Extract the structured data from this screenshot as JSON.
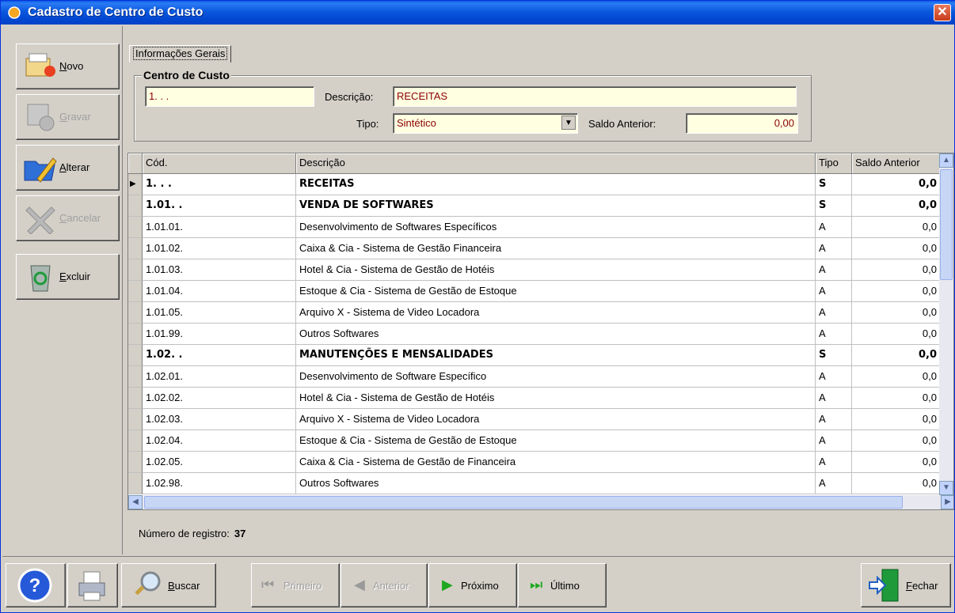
{
  "window": {
    "title": "Cadastro de Centro de Custo",
    "close_glyph": "✕"
  },
  "side_buttons": {
    "novo": {
      "label": "Novo",
      "mnemonic": "N",
      "rest": "ovo",
      "enabled": true
    },
    "gravar": {
      "label": "Gravar",
      "mnemonic": "G",
      "rest": "ravar",
      "enabled": false
    },
    "alterar": {
      "label": "Alterar",
      "mnemonic": "A",
      "rest": "lterar",
      "enabled": true
    },
    "cancelar": {
      "label": "Cancelar",
      "mnemonic": "C",
      "rest": "ancelar",
      "enabled": false
    },
    "excluir": {
      "label": "Excluir",
      "mnemonic": "E",
      "rest": "xcluir",
      "enabled": true
    }
  },
  "tab": {
    "label": "Informações Gerais"
  },
  "form": {
    "group_title": "Centro de Custo",
    "codigo": "1. . .",
    "descricao_label": "Descrição:",
    "descricao": "RECEITAS",
    "tipo_label": "Tipo:",
    "tipo": "Sintético",
    "saldo_label": "Saldo Anterior:",
    "saldo": "0,00"
  },
  "grid": {
    "columns": [
      "Cód.",
      "Descrição",
      "Tipo",
      "Saldo Anterior"
    ],
    "rows": [
      {
        "cod": "1. . .",
        "descricao": "RECEITAS",
        "tipo": "S",
        "saldo": "0,0",
        "bold": true,
        "current": true
      },
      {
        "cod": "1.01. .",
        "descricao": "VENDA DE SOFTWARES",
        "tipo": "S",
        "saldo": "0,0",
        "bold": true
      },
      {
        "cod": "1.01.01.",
        "descricao": "Desenvolvimento de Softwares Específicos",
        "tipo": "A",
        "saldo": "0,0"
      },
      {
        "cod": "1.01.02.",
        "descricao": "Caixa & Cia - Sistema de Gestão Financeira",
        "tipo": "A",
        "saldo": "0,0"
      },
      {
        "cod": "1.01.03.",
        "descricao": "Hotel & Cia - Sistema de Gestão de Hotéis",
        "tipo": "A",
        "saldo": "0,0"
      },
      {
        "cod": "1.01.04.",
        "descricao": "Estoque & Cia - Sistema de Gestão de Estoque",
        "tipo": "A",
        "saldo": "0,0"
      },
      {
        "cod": "1.01.05.",
        "descricao": "Arquivo X - Sistema de Video Locadora",
        "tipo": "A",
        "saldo": "0,0"
      },
      {
        "cod": "1.01.99.",
        "descricao": "Outros Softwares",
        "tipo": "A",
        "saldo": "0,0"
      },
      {
        "cod": "1.02. .",
        "descricao": "MANUTENÇÕES E MENSALIDADES",
        "tipo": "S",
        "saldo": "0,0",
        "bold": true
      },
      {
        "cod": "1.02.01.",
        "descricao": "Desenvolvimento de Software Específico",
        "tipo": "A",
        "saldo": "0,0"
      },
      {
        "cod": "1.02.02.",
        "descricao": "Hotel & Cia - Sistema de Gestão de Hotéis",
        "tipo": "A",
        "saldo": "0,0"
      },
      {
        "cod": "1.02.03.",
        "descricao": "Arquivo X - Sistema de Video Locadora",
        "tipo": "A",
        "saldo": "0,0"
      },
      {
        "cod": "1.02.04.",
        "descricao": "Estoque & Cia - Sistema de Gestão de Estoque",
        "tipo": "A",
        "saldo": "0,0"
      },
      {
        "cod": "1.02.05.",
        "descricao": "Caixa & Cia - Sistema de Gestão de Financeira",
        "tipo": "A",
        "saldo": "0,0"
      },
      {
        "cod": "1.02.98.",
        "descricao": "Outros Softwares",
        "tipo": "A",
        "saldo": "0,0"
      }
    ]
  },
  "status": {
    "label": "Número de registro:",
    "value": "37"
  },
  "bottom_buttons": {
    "buscar": {
      "mnemonic": "B",
      "rest": "uscar",
      "enabled": true
    },
    "primeiro": {
      "label": "Primeiro",
      "enabled": false
    },
    "anterior": {
      "label": "Anterior",
      "enabled": false
    },
    "proximo": {
      "label": "Próximo",
      "enabled": true
    },
    "ultimo": {
      "label": "Último",
      "enabled": true
    },
    "fechar": {
      "mnemonic": "F",
      "rest": "echar",
      "enabled": true
    }
  },
  "colors": {
    "titlebar": "#0A58DD",
    "field_bg": "#FFFFE1",
    "field_text": "#8B0000",
    "panel": "#D4D0C8",
    "green_arrow": "#1FA81F"
  }
}
